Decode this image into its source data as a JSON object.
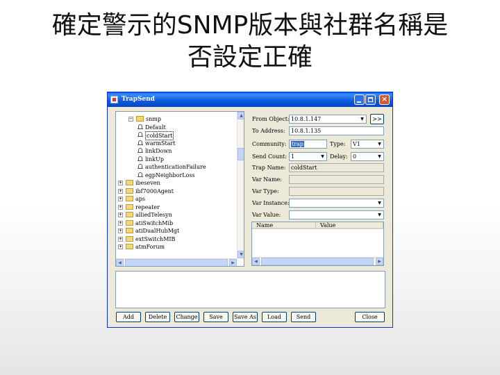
{
  "slide": {
    "title_line1": "確定警示的SNMP版本與社群名稱是",
    "title_line2": "否設定正確"
  },
  "window": {
    "title": "TrapSend",
    "controls": {
      "minimize": "minimize",
      "maximize": "maximize",
      "close": "×"
    }
  },
  "tree": {
    "items": [
      {
        "label": "snmp",
        "expander": "−",
        "icon": "folder-icon"
      },
      {
        "label": "Default",
        "icon": "bell-icon"
      },
      {
        "label": "coldStart",
        "icon": "bell-icon",
        "selected": true
      },
      {
        "label": "warmStart",
        "icon": "bell-icon"
      },
      {
        "label": "linkDown",
        "icon": "bell-icon"
      },
      {
        "label": "linkUp",
        "icon": "bell-icon"
      },
      {
        "label": "authenticationFailure",
        "icon": "bell-icon"
      },
      {
        "label": "egpNeighborLoss",
        "icon": "bell-icon"
      },
      {
        "label": "ibeseven",
        "expander": "+",
        "icon": "folder-icon"
      },
      {
        "label": "ibf7000Agent",
        "expander": "+",
        "icon": "folder-icon"
      },
      {
        "label": "aps",
        "expander": "+",
        "icon": "folder-icon"
      },
      {
        "label": "repeater",
        "expander": "+",
        "icon": "folder-icon"
      },
      {
        "label": "alliedTelesyn",
        "expander": "+",
        "icon": "folder-icon"
      },
      {
        "label": "atiSwitchMib",
        "expander": "+",
        "icon": "folder-icon"
      },
      {
        "label": "atiDualHubMgt",
        "expander": "+",
        "icon": "folder-icon"
      },
      {
        "label": "extSwitchMIB",
        "expander": "+",
        "icon": "folder-icon"
      },
      {
        "label": "atmForum",
        "expander": "+",
        "icon": "folder-icon"
      }
    ],
    "vscroll": {
      "up": "▲",
      "down": "▼"
    },
    "hscroll": {
      "left": "◀",
      "right": "▶"
    }
  },
  "form": {
    "from_object_label": "From Object:",
    "from_object_value": "10.8.1.147",
    "browse_button": ">>",
    "to_address_label": "To Address:",
    "to_address_value": "10.8.1.135",
    "community_label": "Community:",
    "community_value": "trap",
    "type_label": "Type:",
    "type_value": "V1",
    "send_count_label": "Send Count:",
    "send_count_value": "1",
    "delay_label": "Delay:",
    "delay_value": "0",
    "trap_name_label": "Trap Name:",
    "trap_name_value": "coldStart",
    "var_name_label": "Var Name:",
    "var_type_label": "Var Type:",
    "var_instance_label": "Var Instance:",
    "var_value_label": "Var Value:",
    "dropdown_arrow": "▼"
  },
  "var_list": {
    "columns": [
      "Name",
      "Value"
    ],
    "hscroll": {
      "left": "◀",
      "right": "▶"
    }
  },
  "buttons": [
    "Add",
    "Delete",
    "Change",
    "Save",
    "Save As",
    "Load",
    "Send",
    "Close"
  ]
}
